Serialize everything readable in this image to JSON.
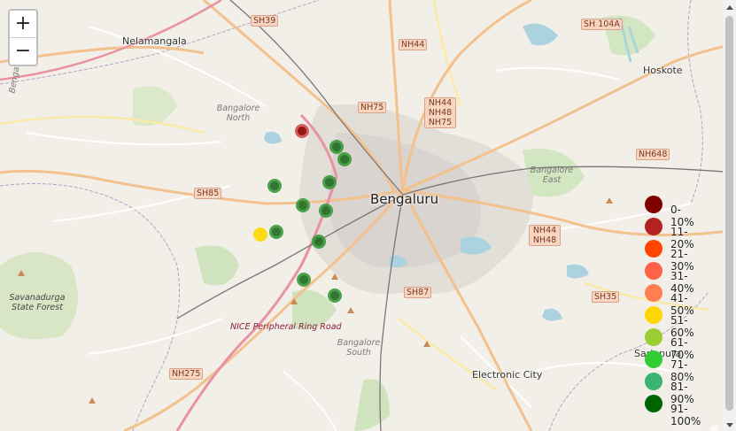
{
  "zoom": {
    "in_label": "+",
    "out_label": "−"
  },
  "places": {
    "bengaluru": "Bengaluru",
    "nelamangala": "Nelamangala",
    "hoskote": "Hoskote",
    "electronic_city": "Electronic City",
    "sarjapura": "Sarjapura",
    "bengaluru_rural": "Bengaluru Rural",
    "bangalore_north": "Bangalore North",
    "bangalore_east": "Bangalore East",
    "bangalore_south": "Bangalore South",
    "savanadurga": "Savanadurga State Forest",
    "nice_road": "NICE Peripheral Ring Road"
  },
  "shields": {
    "sh39": "SH39",
    "nh44": "NH44",
    "sh104a": "SH 104A",
    "nh75": "NH75",
    "nh44_48_75": "NH44 NH48 NH75",
    "nh648": "NH648",
    "sh85": "SH85",
    "nh44_48": "NH44 NH48",
    "sh87": "SH87",
    "sh35": "SH35",
    "nh275": "NH275"
  },
  "markers": [
    {
      "category": "11-20%"
    },
    {
      "category": "91-100%"
    },
    {
      "category": "91-100%"
    },
    {
      "category": "91-100%"
    },
    {
      "category": "91-100%"
    },
    {
      "category": "91-100%"
    },
    {
      "category": "91-100%"
    },
    {
      "category": "51-60%"
    },
    {
      "category": "91-100%"
    },
    {
      "category": "91-100%"
    },
    {
      "category": "91-100%"
    },
    {
      "category": "91-100%"
    }
  ],
  "legend": [
    {
      "label": "0-10%",
      "color": "#800000"
    },
    {
      "label": "11-20%",
      "color": "#b22222"
    },
    {
      "label": "21-30%",
      "color": "#ff4500"
    },
    {
      "label": "31-40%",
      "color": "#ff6347"
    },
    {
      "label": "41-50%",
      "color": "#ff7f50"
    },
    {
      "label": "51-60%",
      "color": "#ffd700"
    },
    {
      "label": "61-70%",
      "color": "#9acd32"
    },
    {
      "label": "71-80%",
      "color": "#32cd32"
    },
    {
      "label": "81-90%",
      "color": "#3cb371"
    },
    {
      "label": "91-100%",
      "color": "#006400"
    }
  ]
}
